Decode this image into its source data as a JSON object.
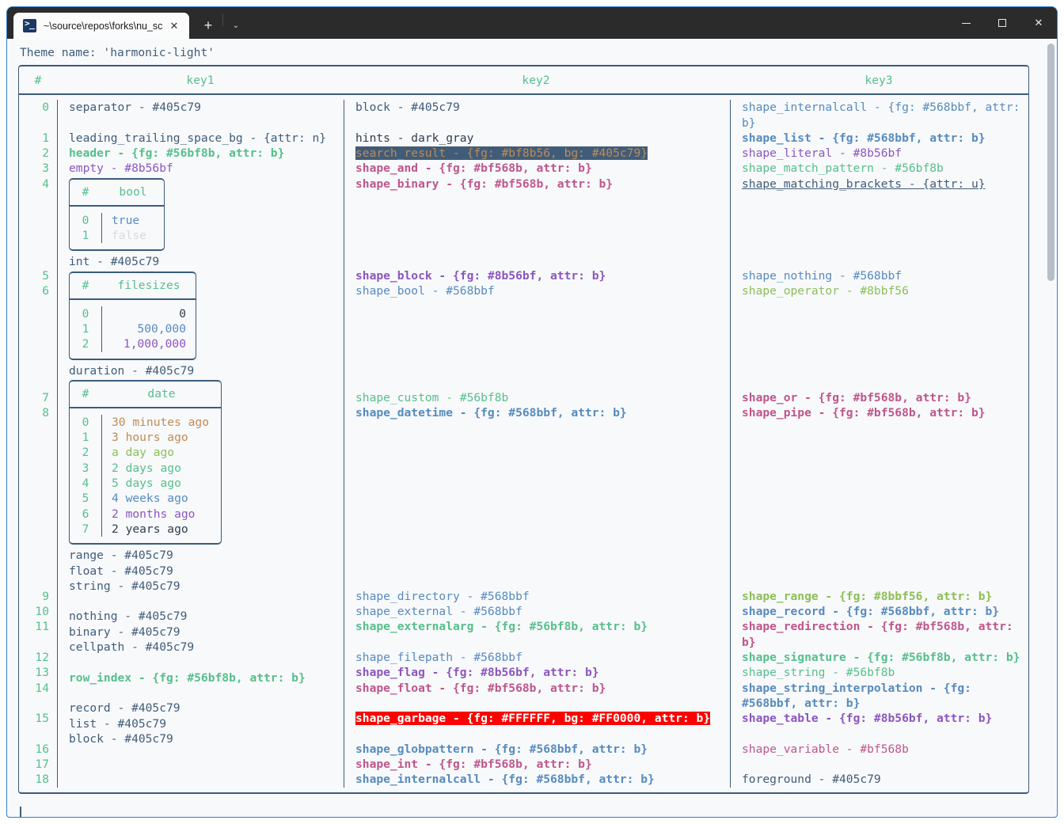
{
  "window": {
    "tab_title": "~\\source\\repos\\forks\\nu_scrip",
    "tab_icon": "powershell-icon",
    "close_label": "✕",
    "newtab_label": "+",
    "dropdown_label": "⌄",
    "minimize_label": "—",
    "maximize_label": "□",
    "close_window_label": "✕"
  },
  "terminal": {
    "theme_line": "Theme name: 'harmonic-light'",
    "prompt_cursor": "|"
  },
  "table": {
    "headers": [
      "#",
      "key1",
      "key2",
      "key3"
    ],
    "index_values": [
      "0",
      "1",
      "2",
      "3",
      "4",
      "5",
      "6",
      "7",
      "8",
      "9",
      "10",
      "11",
      "12",
      "13",
      "14",
      "15",
      "16",
      "17",
      "18"
    ],
    "rows": [
      {
        "index": "0",
        "key1": [
          {
            "t": "separator - #405c79",
            "c": "c-default"
          }
        ],
        "key2": [
          {
            "t": "block - #405c79",
            "c": "c-default"
          }
        ],
        "key3": [
          {
            "t": "shape_internalcall - {fg: #568bbf, attr:",
            "c": "c-blue"
          },
          {
            "t": "b}",
            "c": "c-blue"
          }
        ]
      },
      {
        "index": "1",
        "key1": [
          {
            "t": "leading_trailing_space_bg - {attr: n}",
            "c": "c-default"
          }
        ],
        "key2": [
          {
            "t": "hints - dark_gray",
            "c": "c-dark"
          }
        ],
        "key3": [
          {
            "t": "shape_list - {fg: #568bbf, attr: b}",
            "c": "c-blue bold"
          }
        ]
      },
      {
        "index": "2",
        "key1": [
          {
            "t": "header - {fg: #56bf8b, attr: b}",
            "c": "c-green bold"
          }
        ],
        "key2": [
          {
            "t": "search_result - {fg: #bf8b56, bg: #405c79}",
            "c": "hl-search"
          }
        ],
        "key3": [
          {
            "t": "shape_literal - #8b56bf",
            "c": "c-purple"
          }
        ]
      },
      {
        "index": "3",
        "key1": [
          {
            "t": "empty - #8b56bf",
            "c": "c-purple"
          }
        ],
        "key2": [
          {
            "t": "shape_and - {fg: #bf568b, attr: b}",
            "c": "c-pink bold"
          }
        ],
        "key3": [
          {
            "t": "shape_match_pattern - #56bf8b",
            "c": "c-green"
          }
        ]
      },
      {
        "index": "4",
        "key1": [],
        "key2": [
          {
            "t": "shape_binary - {fg: #bf568b, attr: b}",
            "c": "c-pink bold"
          }
        ],
        "key3": [
          {
            "t": "shape_matching_brackets - {attr: u}",
            "c": "c-default und"
          }
        ]
      },
      {
        "index": "5",
        "key1": [
          {
            "t": "int - #405c79",
            "c": "c-default"
          }
        ],
        "key2": [
          {
            "t": "shape_block - {fg: #8b56bf, attr: b}",
            "c": "c-purple bold"
          }
        ],
        "key3": [
          {
            "t": "shape_nothing - #568bbf",
            "c": "c-blue"
          }
        ]
      },
      {
        "index": "6",
        "key1": [],
        "key2": [
          {
            "t": "shape_bool - #568bbf",
            "c": "c-blue"
          }
        ],
        "key3": [
          {
            "t": "shape_operator - #8bbf56",
            "c": "c-lime"
          }
        ]
      },
      {
        "index": "7",
        "key1": [
          {
            "t": "duration - #405c79",
            "c": "c-default"
          }
        ],
        "key2": [
          {
            "t": "shape_custom - #56bf8b",
            "c": "c-green"
          }
        ],
        "key3": [
          {
            "t": "shape_or - {fg: #bf568b, attr: b}",
            "c": "c-pink bold"
          }
        ]
      },
      {
        "index": "8",
        "key1": [],
        "key2": [
          {
            "t": "shape_datetime - {fg: #568bbf, attr: b}",
            "c": "c-blue bold"
          }
        ],
        "key3": [
          {
            "t": "shape_pipe - {fg: #bf568b, attr: b}",
            "c": "c-pink bold"
          }
        ]
      },
      {
        "index": "9",
        "key1": [
          {
            "t": "range - #405c79",
            "c": "c-default"
          }
        ],
        "key2": [
          {
            "t": "shape_directory - #568bbf",
            "c": "c-blue"
          }
        ],
        "key3": [
          {
            "t": "shape_range - {fg: #8bbf56, attr: b}",
            "c": "c-lime bold"
          }
        ]
      },
      {
        "index": "10",
        "key1": [
          {
            "t": "float - #405c79",
            "c": "c-default"
          }
        ],
        "key2": [
          {
            "t": "shape_external - #568bbf",
            "c": "c-blue"
          }
        ],
        "key3": [
          {
            "t": "shape_record - {fg: #568bbf, attr: b}",
            "c": "c-blue bold"
          }
        ]
      },
      {
        "index": "11",
        "key1": [
          {
            "t": "string - #405c79",
            "c": "c-default"
          }
        ],
        "key2": [
          {
            "t": "shape_externalarg - {fg: #56bf8b, attr: b}",
            "c": "c-green bold"
          }
        ],
        "key3": [
          {
            "t": "shape_redirection - {fg: #bf568b, attr:",
            "c": "c-pink bold"
          },
          {
            "t": "b}",
            "c": "c-pink bold"
          }
        ]
      },
      {
        "index": "12",
        "key1": [
          {
            "t": "nothing - #405c79",
            "c": "c-default"
          }
        ],
        "key2": [
          {
            "t": "shape_filepath - #568bbf",
            "c": "c-blue"
          }
        ],
        "key3": [
          {
            "t": "shape_signature - {fg: #56bf8b, attr: b}",
            "c": "c-green bold"
          }
        ]
      },
      {
        "index": "13",
        "key1": [
          {
            "t": "binary - #405c79",
            "c": "c-default"
          }
        ],
        "key2": [
          {
            "t": "shape_flag - {fg: #8b56bf, attr: b}",
            "c": "c-purple bold"
          }
        ],
        "key3": [
          {
            "t": "shape_string - #56bf8b",
            "c": "c-green"
          }
        ]
      },
      {
        "index": "14",
        "key1": [
          {
            "t": "cellpath - #405c79",
            "c": "c-default"
          }
        ],
        "key2": [
          {
            "t": "shape_float - {fg: #bf568b, attr: b}",
            "c": "c-pink bold"
          }
        ],
        "key3": [
          {
            "t": "shape_string_interpolation - {fg:",
            "c": "c-blue bold"
          },
          {
            "t": "#568bbf, attr: b}",
            "c": "c-blue bold"
          }
        ]
      },
      {
        "index": "15",
        "key1": [
          {
            "t": "row_index - {fg: #56bf8b, attr: b}",
            "c": "c-green bold"
          }
        ],
        "key2": [
          {
            "t": "shape_garbage - {fg: #FFFFFF, bg: #FF0000, attr: b}",
            "c": "hl-garbage"
          }
        ],
        "key3": [
          {
            "t": "shape_table - {fg: #8b56bf, attr: b}",
            "c": "c-purple bold"
          }
        ]
      },
      {
        "index": "16",
        "key1": [
          {
            "t": "record - #405c79",
            "c": "c-default"
          }
        ],
        "key2": [
          {
            "t": "shape_globpattern - {fg: #568bbf, attr: b}",
            "c": "c-blue bold"
          }
        ],
        "key3": [
          {
            "t": "shape_variable - #bf568b",
            "c": "c-pink"
          }
        ]
      },
      {
        "index": "17",
        "key1": [
          {
            "t": "list - #405c79",
            "c": "c-default"
          }
        ],
        "key2": [
          {
            "t": "shape_int - {fg: #bf568b, attr: b}",
            "c": "c-pink bold"
          }
        ],
        "key3": []
      },
      {
        "index": "18",
        "key1": [
          {
            "t": "block - #405c79",
            "c": "c-default"
          }
        ],
        "key2": [
          {
            "t": "shape_internalcall - {fg: #568bbf, attr: b}",
            "c": "c-blue bold"
          }
        ],
        "key3": [
          {
            "t": "foreground - #405c79",
            "c": "c-default"
          }
        ]
      }
    ],
    "nested_tables": [
      {
        "name": "bool",
        "header": [
          "#",
          "bool"
        ],
        "rows": [
          {
            "index": "0",
            "value": "true",
            "color": "c-blue"
          },
          {
            "index": "1",
            "value": "false",
            "color": "c-gray"
          }
        ]
      },
      {
        "name": "filesizes",
        "header": [
          "#",
          "filesizes"
        ],
        "rows": [
          {
            "index": "0",
            "value": "0",
            "color": "c-dark"
          },
          {
            "index": "1",
            "value": "500,000",
            "color": "c-blue"
          },
          {
            "index": "2",
            "value": "1,000,000",
            "color": "c-purple"
          }
        ]
      },
      {
        "name": "date",
        "header": [
          "#",
          "date"
        ],
        "rows": [
          {
            "index": "0",
            "value": "30 minutes ago",
            "color": "c-orange"
          },
          {
            "index": "1",
            "value": "3 hours ago",
            "color": "c-orange"
          },
          {
            "index": "2",
            "value": "a day ago",
            "color": "c-lime"
          },
          {
            "index": "3",
            "value": "2 days ago",
            "color": "c-green"
          },
          {
            "index": "4",
            "value": "5 days ago",
            "color": "c-green"
          },
          {
            "index": "5",
            "value": "4 weeks ago",
            "color": "c-blue"
          },
          {
            "index": "6",
            "value": "2 months ago",
            "color": "c-purple"
          },
          {
            "index": "7",
            "value": "2 years ago",
            "color": "c-dark"
          }
        ]
      }
    ]
  },
  "colors": {
    "accent_border": "#3b5b7c",
    "green": "#56bf8b",
    "blue": "#568bbf",
    "purple": "#8b56bf",
    "pink": "#bf568b",
    "lime": "#8bbf56",
    "orange": "#bf8b56",
    "foreground": "#405c79",
    "garbage_bg": "#FF0000",
    "garbage_fg": "#FFFFFF",
    "search_bg": "#405c79",
    "search_fg": "#bf8b56"
  }
}
